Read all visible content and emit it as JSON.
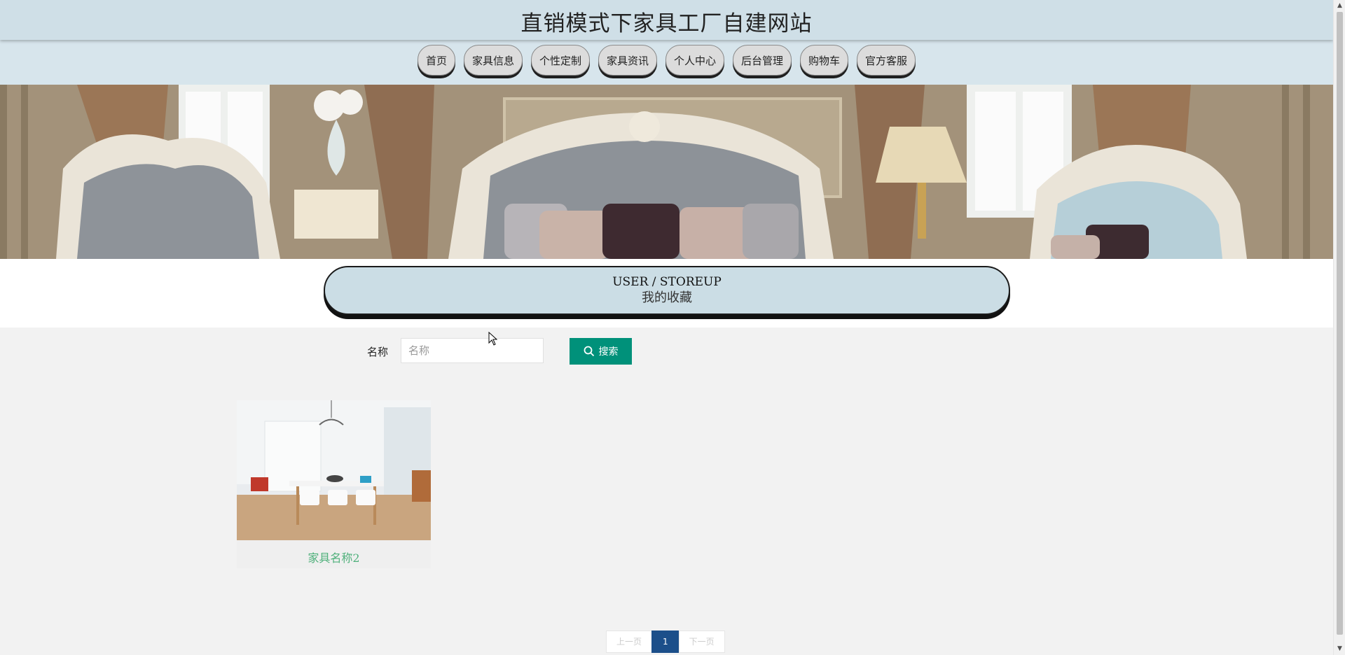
{
  "header": {
    "title": "直销模式下家具工厂自建网站"
  },
  "nav": {
    "items": [
      {
        "label": "首页",
        "name": "nav-home"
      },
      {
        "label": "家具信息",
        "name": "nav-furniture-info"
      },
      {
        "label": "个性定制",
        "name": "nav-custom"
      },
      {
        "label": "家具资讯",
        "name": "nav-news"
      },
      {
        "label": "个人中心",
        "name": "nav-personal-center"
      },
      {
        "label": "后台管理",
        "name": "nav-admin"
      },
      {
        "label": "购物车",
        "name": "nav-cart"
      },
      {
        "label": "官方客服",
        "name": "nav-customer-service"
      }
    ]
  },
  "section_title": {
    "en": "USER / STOREUP",
    "zh": "我的收藏"
  },
  "search": {
    "label": "名称",
    "placeholder": "名称",
    "value": "",
    "button_label": "搜索",
    "button_icon": "search-icon"
  },
  "items": [
    {
      "name": "家具名称2"
    }
  ],
  "pagination": {
    "prev_label": "上一页",
    "current_page": "1",
    "next_label": "下一页"
  },
  "colors": {
    "header_bg": "#cfdfe7",
    "nav_bg": "#d7e5ec",
    "title_box_bg": "#cbdde5",
    "search_button": "#00917a",
    "item_name": "#4fb07b",
    "pagination_active": "#1c4f8a"
  }
}
